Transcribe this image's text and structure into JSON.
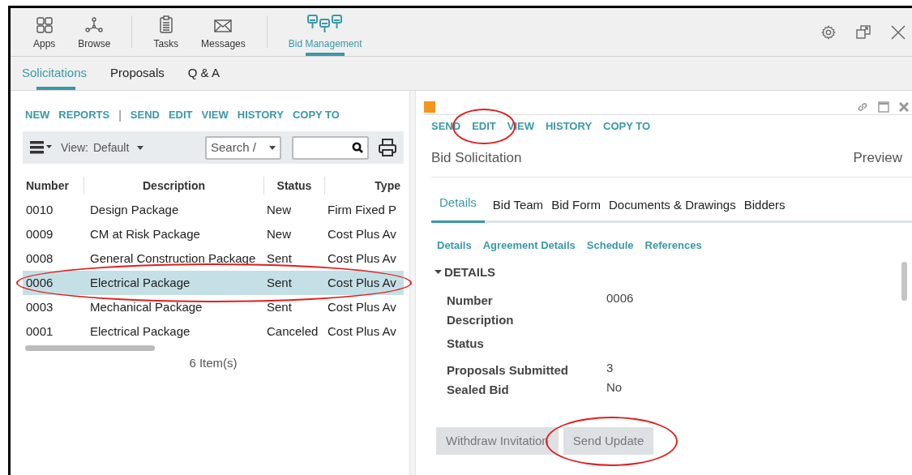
{
  "app_bar": {
    "items": [
      {
        "label": "Apps",
        "selected": false
      },
      {
        "label": "Browse",
        "selected": false
      },
      {
        "label": "Tasks",
        "selected": false
      },
      {
        "label": "Messages",
        "selected": false
      },
      {
        "label": "Bid Management",
        "selected": true
      }
    ]
  },
  "module_tabs": [
    {
      "label": "Solicitations",
      "selected": true
    },
    {
      "label": "Proposals",
      "selected": false
    },
    {
      "label": "Q & A",
      "selected": false
    }
  ],
  "list_actions": [
    {
      "label": "NEW",
      "kind": "action"
    },
    {
      "label": "REPORTS",
      "kind": "action"
    },
    {
      "label": "|",
      "kind": "separator"
    },
    {
      "label": "SEND",
      "kind": "action"
    },
    {
      "label": "EDIT",
      "kind": "action"
    },
    {
      "label": "VIEW",
      "kind": "action"
    },
    {
      "label": "HISTORY",
      "kind": "action"
    },
    {
      "label": "COPY TO",
      "kind": "action"
    }
  ],
  "toolbar": {
    "view_label": "View:",
    "view_value": "Default",
    "search_select": "Search /"
  },
  "table": {
    "columns": [
      "Number",
      "Description",
      "Status",
      "Type"
    ],
    "rows": [
      {
        "cells": [
          "0010",
          "Design Package",
          "New",
          "Firm Fixed P"
        ],
        "selected": false,
        "circled": false
      },
      {
        "cells": [
          "0009",
          "CM at Risk Package",
          "New",
          "Cost Plus Av"
        ],
        "selected": false,
        "circled": false
      },
      {
        "cells": [
          "0008",
          "General Construction Package",
          "Sent",
          "Cost Plus Av"
        ],
        "selected": false,
        "circled": false
      },
      {
        "cells": [
          "0006",
          "Electrical Package",
          "Sent",
          "Cost Plus Av"
        ],
        "selected": true,
        "circled": true
      },
      {
        "cells": [
          "0003",
          "Mechanical Package",
          "Sent",
          "Cost Plus Av"
        ],
        "selected": false,
        "circled": false
      },
      {
        "cells": [
          "0001",
          "Electrical Package",
          "Canceled",
          "Cost Plus Av"
        ],
        "selected": false,
        "circled": false
      }
    ],
    "item_count": "6 Item(s)"
  },
  "detail": {
    "actions": [
      {
        "label": "SEND",
        "circled": false
      },
      {
        "label": "EDIT",
        "circled": true
      },
      {
        "label": "VIEW",
        "circled": false
      },
      {
        "label": "HISTORY",
        "circled": false
      },
      {
        "label": "COPY TO",
        "circled": false
      }
    ],
    "title": "Bid Solicitation",
    "mode": "Preview",
    "tabs": [
      {
        "label": "Details",
        "selected": true
      },
      {
        "label": "Bid Team",
        "selected": false
      },
      {
        "label": "Bid Form",
        "selected": false
      },
      {
        "label": "Documents & Drawings",
        "selected": false
      },
      {
        "label": "Bidders",
        "selected": false
      }
    ],
    "sub_links": [
      "Details",
      "Agreement Details",
      "Schedule",
      "References"
    ],
    "section": {
      "title": "DETAILS",
      "expanded": true
    },
    "fields": [
      {
        "label": "Number",
        "value": "0006"
      },
      {
        "label": "Description"
      },
      {
        "label": "Status"
      },
      {
        "label": "Proposals Submitted",
        "value": "3"
      },
      {
        "label": "Sealed Bid",
        "value": "No"
      }
    ],
    "buttons": [
      {
        "label": "Withdraw Invitation",
        "circled": false
      },
      {
        "label": "Send Update",
        "circled": true
      }
    ]
  }
}
